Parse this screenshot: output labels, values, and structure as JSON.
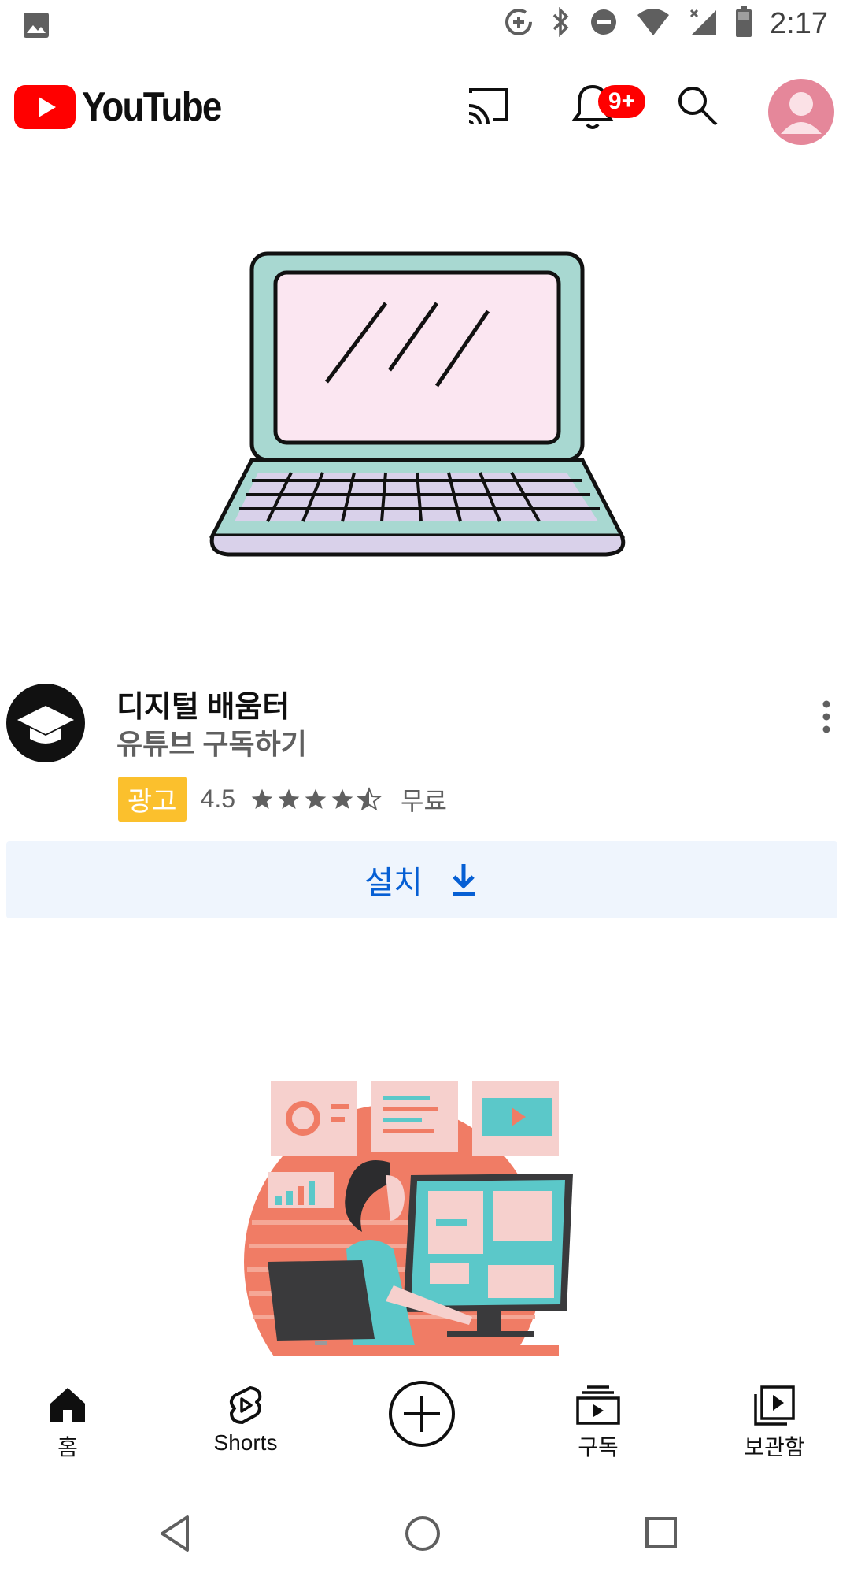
{
  "status_bar": {
    "time": "2:17",
    "icons": [
      "image-icon",
      "data-saver-icon",
      "bluetooth-icon",
      "do-not-disturb-icon",
      "wifi-icon",
      "cellular-no-signal-icon",
      "battery-icon"
    ]
  },
  "header": {
    "logo_text": "YouTube",
    "notification_badge": "9+",
    "colors": {
      "brand_red": "#ff0000"
    }
  },
  "ad": {
    "title": "디지털 배움터",
    "subtitle": "유튜브 구독하기",
    "badge": "광고",
    "rating": "4.5",
    "stars": 4.5,
    "price": "무료",
    "install_label": "설치"
  },
  "bottom_nav": {
    "items": [
      {
        "label": "홈",
        "icon": "home-icon"
      },
      {
        "label": "Shorts",
        "icon": "shorts-icon"
      },
      {
        "label": "",
        "icon": "create-icon"
      },
      {
        "label": "구독",
        "icon": "subscriptions-icon"
      },
      {
        "label": "보관함",
        "icon": "library-icon"
      }
    ]
  },
  "system_nav": {
    "icons": [
      "back-icon",
      "home-circle-icon",
      "recents-icon"
    ]
  }
}
